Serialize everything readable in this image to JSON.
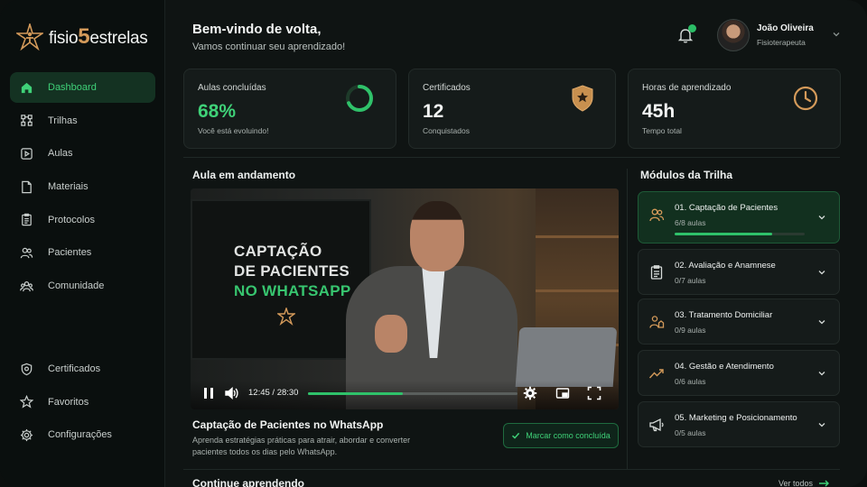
{
  "brand": {
    "prefix": "fisio",
    "number": "5",
    "suffix": "estrelas"
  },
  "sidebar": {
    "items": [
      {
        "label": "Dashboard",
        "icon": "home-icon",
        "active": true
      },
      {
        "label": "Trilhas",
        "icon": "route-icon"
      },
      {
        "label": "Aulas",
        "icon": "play-square-icon"
      },
      {
        "label": "Materiais",
        "icon": "document-icon"
      },
      {
        "label": "Protocolos",
        "icon": "clipboard-icon"
      },
      {
        "label": "Pacientes",
        "icon": "users-icon"
      },
      {
        "label": "Comunidade",
        "icon": "community-icon"
      }
    ],
    "bottom_items": [
      {
        "label": "Certificados",
        "icon": "shield-icon"
      },
      {
        "label": "Favoritos",
        "icon": "star-icon"
      },
      {
        "label": "Configurações",
        "icon": "gear-icon"
      }
    ]
  },
  "header": {
    "title": "Bem-vindo de volta,",
    "subtitle": "Vamos continuar seu aprendizado!",
    "user": {
      "name": "João Oliveira",
      "role": "Fisioterapeuta"
    }
  },
  "stats": {
    "lessons": {
      "label": "Aulas concluídas",
      "value": "68%",
      "sub": "Você está evoluindo!",
      "progress": 0.68
    },
    "certificates": {
      "label": "Certificados",
      "value": "12",
      "sub": "Conquistados"
    },
    "hours": {
      "label": "Horas de aprendizado",
      "value": "45h",
      "sub": "Tempo total"
    }
  },
  "current_lesson": {
    "section_title": "Aula em andamento",
    "thumbnail_lines": [
      "CAPTAÇÃO",
      "DE PACIENTES",
      "NO WHATSAPP"
    ],
    "time": "12:45 / 28:30",
    "progress": 0.4546,
    "title": "Captação de Pacientes no WhatsApp",
    "description": "Aprenda estratégias práticas para atrair, abordar e converter pacientes todos os dias pelo WhatsApp.",
    "mark_button": "Marcar como concluída"
  },
  "modules": {
    "section_title": "Módulos da Trilha",
    "items": [
      {
        "title": "01. Captação de Pacientes",
        "sub": "6/8 aulas",
        "icon": "users-icon",
        "active": true,
        "progress": 0.75
      },
      {
        "title": "02. Avaliação e Anamnese",
        "sub": "0/7 aulas",
        "icon": "clipboard-icon"
      },
      {
        "title": "03. Tratamento Domiciliar",
        "sub": "0/9 aulas",
        "icon": "home-care-icon"
      },
      {
        "title": "04. Gestão e Atendimento",
        "sub": "0/6 aulas",
        "icon": "trend-icon"
      },
      {
        "title": "05. Marketing e Posicionamento",
        "sub": "0/5 aulas",
        "icon": "megaphone-icon"
      }
    ]
  },
  "continue": {
    "title": "Continue aprendendo",
    "see_all": "Ver todos"
  },
  "colors": {
    "accent": "#3fd178",
    "gold": "#d49a5a",
    "background": "#0f1413"
  }
}
